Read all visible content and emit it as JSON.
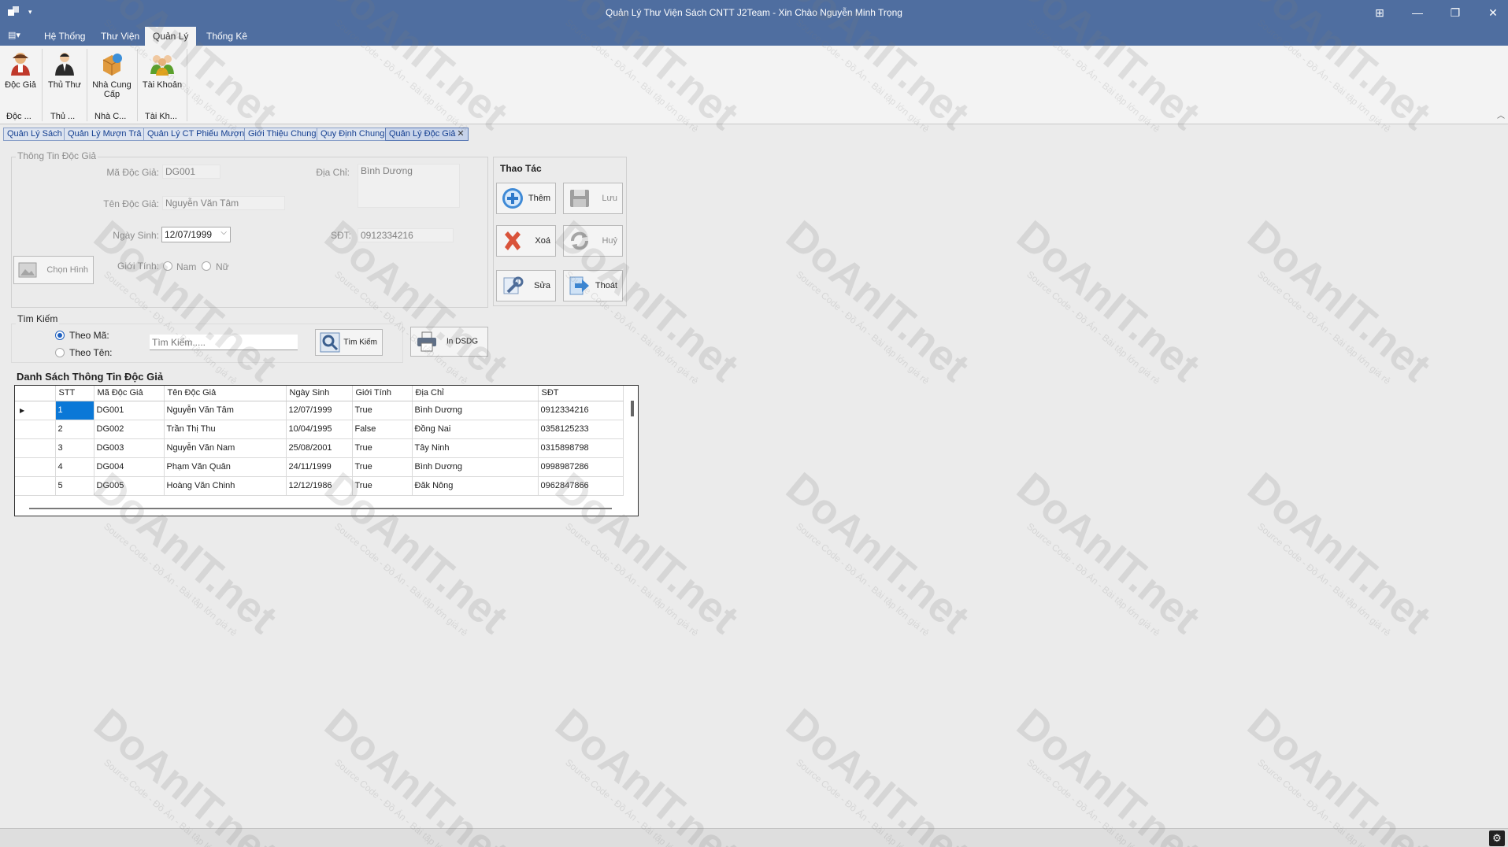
{
  "window": {
    "title": "Quản Lý Thư Viện Sách CNTT J2Team - Xin Chào Nguyễn Minh Trọng",
    "controls": [
      "⊞",
      "—",
      "❐",
      "✕"
    ]
  },
  "ribbon": {
    "tabs": [
      "Hệ Thống",
      "Thư Viện",
      "Quản Lý",
      "Thống Kê"
    ],
    "active_tab": "Quản Lý",
    "buttons": [
      {
        "label": "Độc Giả",
        "icon": "reader-icon",
        "group": "Độc ..."
      },
      {
        "label": "Thủ Thư",
        "icon": "librarian-icon",
        "group": "Thủ ..."
      },
      {
        "label": "Nhà Cung Cấp",
        "icon": "supplier-icon",
        "group": "Nhà C..."
      },
      {
        "label": "Tài Khoản",
        "icon": "accounts-icon",
        "group": "Tài Kh..."
      }
    ]
  },
  "mdi_tabs": [
    "Quản Lý Sách",
    "Quản Lý Mượn Trả",
    "Quản Lý CT Phiếu Mượn",
    "Giới Thiệu Chung",
    "Quy Định Chung",
    "Quản Lý Độc Giả"
  ],
  "reader_info": {
    "title": "Thông Tin Độc Giả",
    "ma_label": "Mã Độc Giả:",
    "ma_value": "DG001",
    "ten_label": "Tên Độc Giả:",
    "ten_value": "Nguyễn Văn Tâm",
    "ngaysinh_label": "Ngày Sinh:",
    "ngaysinh_value": "12/07/1999",
    "gioitinh_label": "Giới Tính:",
    "gender_male": "Nam",
    "gender_female": "Nữ",
    "diachi_label": "Địa Chỉ:",
    "diachi_value": "Bình Dương",
    "sdt_label": "SĐT:",
    "sdt_value": "0912334216",
    "choose_image": "Chọn Hình"
  },
  "actions": {
    "title": "Thao Tác",
    "them": "Thêm",
    "luu": "Lưu",
    "xoa": "Xoá",
    "huy": "Huỷ",
    "sua": "Sửa",
    "thoat": "Thoát"
  },
  "search": {
    "title": "Tìm Kiếm",
    "by_id": "Theo Mã:",
    "by_name": "Theo Tên:",
    "placeholder": "Tìm Kiếm.....",
    "search_button": "Tìm Kiếm",
    "print_button": "In DSDG"
  },
  "list": {
    "title": "Danh Sách Thông Tin Độc Giả",
    "columns": [
      "STT",
      "Mã Độc Giả",
      "Tên Độc Giả",
      "Ngày Sinh",
      "Giới Tính",
      "Địa Chỉ",
      "SĐT"
    ],
    "rows": [
      [
        "1",
        "DG001",
        "Nguyễn Văn Tâm",
        "12/07/1999",
        "True",
        "Bình Dương",
        "0912334216"
      ],
      [
        "2",
        "DG002",
        "Trần Thị Thu",
        "10/04/1995",
        "False",
        "Đồng Nai",
        "0358125233"
      ],
      [
        "3",
        "DG003",
        "Nguyễn Văn Nam",
        "25/08/2001",
        "True",
        "Tây Ninh",
        "0315898798"
      ],
      [
        "4",
        "DG004",
        "Phạm Văn Quân",
        "24/11/1999",
        "True",
        "Bình Dương",
        "0998987286"
      ],
      [
        "5",
        "DG005",
        "Hoàng Văn Chinh",
        "12/12/1986",
        "True",
        "Đăk Nông",
        "0962847866"
      ]
    ]
  },
  "watermark": {
    "brand": "DoAnIT.net",
    "tagline": "Source Code - Đồ Án - Bài tập lớn giá rẻ"
  }
}
